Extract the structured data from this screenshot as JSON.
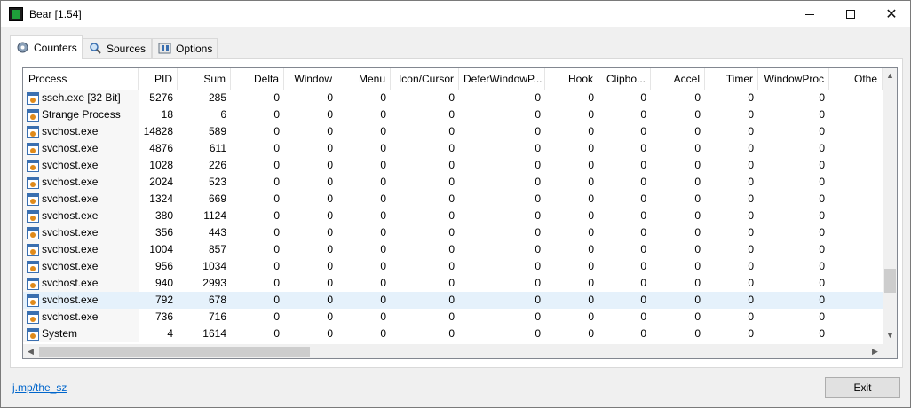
{
  "window": {
    "title": "Bear [1.54]"
  },
  "tabs": [
    {
      "label": "Counters",
      "icon": "gear-icon"
    },
    {
      "label": "Sources",
      "icon": "magnifier-icon"
    },
    {
      "label": "Options",
      "icon": "options-icon"
    }
  ],
  "table": {
    "columns": [
      "Process",
      "PID",
      "Sum",
      "Delta",
      "Window",
      "Menu",
      "Icon/Cursor",
      "DeferWindowP...",
      "Hook",
      "Clipbo...",
      "Accel",
      "Timer",
      "WindowProc",
      "Othe"
    ],
    "rows": [
      [
        "sseh.exe [32 Bit]",
        "5276",
        "285",
        "0",
        "0",
        "0",
        "0",
        "0",
        "0",
        "0",
        "0",
        "0",
        "0",
        ""
      ],
      [
        "Strange Process",
        "18",
        "6",
        "0",
        "0",
        "0",
        "0",
        "0",
        "0",
        "0",
        "0",
        "0",
        "0",
        ""
      ],
      [
        "svchost.exe",
        "14828",
        "589",
        "0",
        "0",
        "0",
        "0",
        "0",
        "0",
        "0",
        "0",
        "0",
        "0",
        ""
      ],
      [
        "svchost.exe",
        "4876",
        "611",
        "0",
        "0",
        "0",
        "0",
        "0",
        "0",
        "0",
        "0",
        "0",
        "0",
        ""
      ],
      [
        "svchost.exe",
        "1028",
        "226",
        "0",
        "0",
        "0",
        "0",
        "0",
        "0",
        "0",
        "0",
        "0",
        "0",
        ""
      ],
      [
        "svchost.exe",
        "2024",
        "523",
        "0",
        "0",
        "0",
        "0",
        "0",
        "0",
        "0",
        "0",
        "0",
        "0",
        ""
      ],
      [
        "svchost.exe",
        "1324",
        "669",
        "0",
        "0",
        "0",
        "0",
        "0",
        "0",
        "0",
        "0",
        "0",
        "0",
        ""
      ],
      [
        "svchost.exe",
        "380",
        "1124",
        "0",
        "0",
        "0",
        "0",
        "0",
        "0",
        "0",
        "0",
        "0",
        "0",
        ""
      ],
      [
        "svchost.exe",
        "356",
        "443",
        "0",
        "0",
        "0",
        "0",
        "0",
        "0",
        "0",
        "0",
        "0",
        "0",
        ""
      ],
      [
        "svchost.exe",
        "1004",
        "857",
        "0",
        "0",
        "0",
        "0",
        "0",
        "0",
        "0",
        "0",
        "0",
        "0",
        ""
      ],
      [
        "svchost.exe",
        "956",
        "1034",
        "0",
        "0",
        "0",
        "0",
        "0",
        "0",
        "0",
        "0",
        "0",
        "0",
        ""
      ],
      [
        "svchost.exe",
        "940",
        "2993",
        "0",
        "0",
        "0",
        "0",
        "0",
        "0",
        "0",
        "0",
        "0",
        "0",
        ""
      ],
      [
        "svchost.exe",
        "792",
        "678",
        "0",
        "0",
        "0",
        "0",
        "0",
        "0",
        "0",
        "0",
        "0",
        "0",
        ""
      ],
      [
        "svchost.exe",
        "736",
        "716",
        "0",
        "0",
        "0",
        "0",
        "0",
        "0",
        "0",
        "0",
        "0",
        "0",
        ""
      ],
      [
        "System",
        "4",
        "1614",
        "0",
        "0",
        "0",
        "0",
        "0",
        "0",
        "0",
        "0",
        "0",
        "0",
        ""
      ]
    ],
    "selected_row": 12
  },
  "footer": {
    "link": "j.mp/the_sz",
    "exit_label": "Exit"
  },
  "colors": {
    "selected_row": "#e5f1fb",
    "link": "#0066cc"
  }
}
